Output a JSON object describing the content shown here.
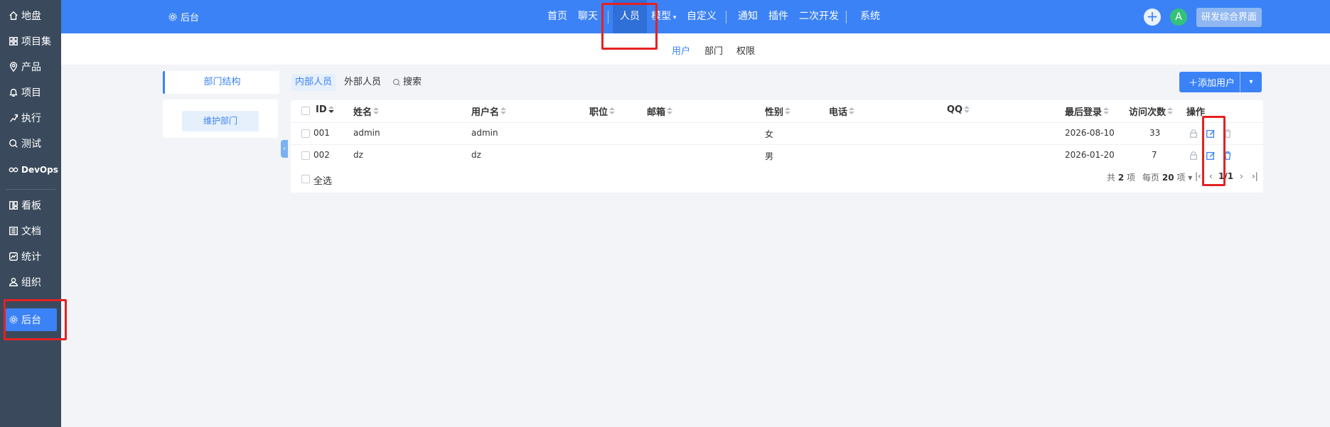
{
  "sidebar": {
    "items": [
      {
        "label": "地盘",
        "icon": "home-icon"
      },
      {
        "label": "项目集",
        "icon": "grid-icon"
      },
      {
        "label": "产品",
        "icon": "map-pin-icon"
      },
      {
        "label": "项目",
        "icon": "bell-icon"
      },
      {
        "label": "执行",
        "icon": "run-icon"
      },
      {
        "label": "测试",
        "icon": "search-icon"
      },
      {
        "label": "DevOps",
        "icon": "infinity-icon"
      },
      {
        "label": "看板",
        "icon": "kanban-icon"
      },
      {
        "label": "文档",
        "icon": "doc-icon"
      },
      {
        "label": "统计",
        "icon": "chart-icon"
      },
      {
        "label": "组织",
        "icon": "user-icon"
      },
      {
        "label": "后台",
        "icon": "gear-icon"
      }
    ]
  },
  "header": {
    "brand": "后台",
    "nav": [
      "首页",
      "聊天",
      "人员",
      "模型",
      "自定义",
      "通知",
      "插件",
      "二次开发",
      "系统"
    ],
    "active_nav": "人员",
    "avatar": "A",
    "workspace": "研发综合界面"
  },
  "subnav": {
    "items": [
      "用户",
      "部门",
      "权限"
    ],
    "active": "用户"
  },
  "left_panel": {
    "tab": "部门结构",
    "maintain_button": "维护部门"
  },
  "content_tabs": {
    "internal": "内部人员",
    "external": "外部人员",
    "search": "搜索"
  },
  "add_user": "添加用户",
  "table": {
    "headers": {
      "id": "ID",
      "realname": "姓名",
      "account": "用户名",
      "role": "职位",
      "email": "邮箱",
      "gender": "性别",
      "phone": "电话",
      "qq": "QQ",
      "last": "最后登录",
      "visits": "访问次数",
      "actions": "操作"
    },
    "rows": [
      {
        "id": "001",
        "realname": "admin",
        "account": "admin",
        "gender": "女",
        "last": "2026-08-10",
        "visits": "33"
      },
      {
        "id": "002",
        "realname": "dz",
        "account": "dz",
        "gender": "男",
        "last": "2026-01-20",
        "visits": "7"
      }
    ],
    "select_all": "全选",
    "pager": {
      "total_prefix": "共",
      "total": "2",
      "total_suffix": "项",
      "per_page_prefix": "每页",
      "per_page": "20",
      "per_page_suffix": "项",
      "page": "1/1"
    }
  },
  "colors": {
    "primary": "#3b82f6",
    "sidebar": "#3a4a5c",
    "highlight": "#e32222"
  }
}
